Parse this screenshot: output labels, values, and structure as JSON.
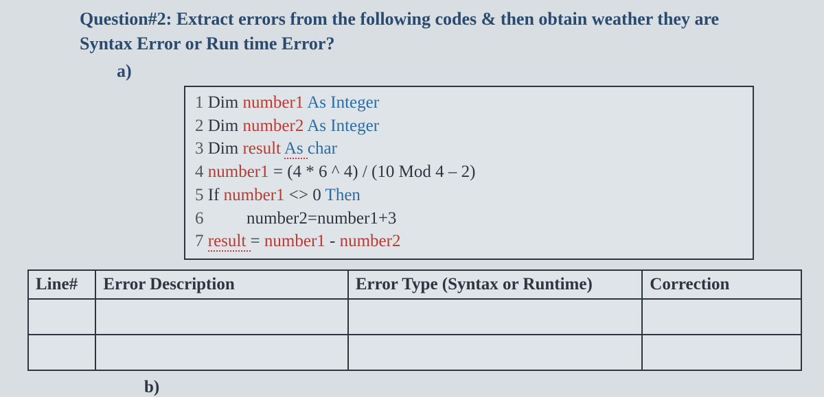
{
  "question": {
    "prompt": "Question#2: Extract errors from the following codes & then obtain weather they are Syntax Error or Run time Error?",
    "part_a_label": "a)",
    "part_b_label": "b)"
  },
  "code": {
    "lines": [
      {
        "n": "1",
        "tokens": [
          {
            "t": "Dim ",
            "c": "kw-dim"
          },
          {
            "t": "number1 ",
            "c": "ident-red"
          },
          {
            "t": "As ",
            "c": "kw-as-plain"
          },
          {
            "t": "Integer",
            "c": "kw-int"
          }
        ]
      },
      {
        "n": "2",
        "tokens": [
          {
            "t": "Dim ",
            "c": "kw-dim"
          },
          {
            "t": "number2 ",
            "c": "ident-red"
          },
          {
            "t": "As ",
            "c": "kw-as-plain"
          },
          {
            "t": "Integer",
            "c": "kw-int"
          }
        ]
      },
      {
        "n": "3",
        "tokens": [
          {
            "t": "Dim ",
            "c": "kw-dim"
          },
          {
            "t": "result ",
            "c": "ident-red"
          },
          {
            "t": "As ",
            "c": "kw-as"
          },
          {
            "t": "char",
            "c": "kw-int"
          }
        ]
      },
      {
        "n": "4",
        "tokens": [
          {
            "t": "number1 ",
            "c": "ident-red"
          },
          {
            "t": "= (4 * 6 ^ 4) / (10 Mod 4 – 2)",
            "c": "plain"
          }
        ]
      },
      {
        "n": "5",
        "tokens": [
          {
            "t": "If ",
            "c": "kw-if"
          },
          {
            "t": "number1 ",
            "c": "ident-red"
          },
          {
            "t": "<> ",
            "c": "op"
          },
          {
            "t": "0 ",
            "c": "plain"
          },
          {
            "t": "Then",
            "c": "kw-then"
          }
        ]
      },
      {
        "n": "6",
        "tokens": [
          {
            "t": "         number2=number1+3",
            "c": "plain"
          }
        ]
      },
      {
        "n": "7",
        "tokens": [
          {
            "t": "result ",
            "c": "ident-red underline-wavy"
          },
          {
            "t": "= ",
            "c": "plain"
          },
          {
            "t": "number1 ",
            "c": "ident-red"
          },
          {
            "t": "- ",
            "c": "plain"
          },
          {
            "t": "number2",
            "c": "ident-red"
          }
        ]
      }
    ]
  },
  "table": {
    "headers": {
      "line": "Line#",
      "desc": "Error Description",
      "type": "Error Type (Syntax or Runtime)",
      "corr": "Correction"
    },
    "rows": [
      {
        "line": "",
        "desc": "",
        "type": "",
        "corr": ""
      },
      {
        "line": "",
        "desc": "",
        "type": "",
        "corr": ""
      }
    ]
  }
}
